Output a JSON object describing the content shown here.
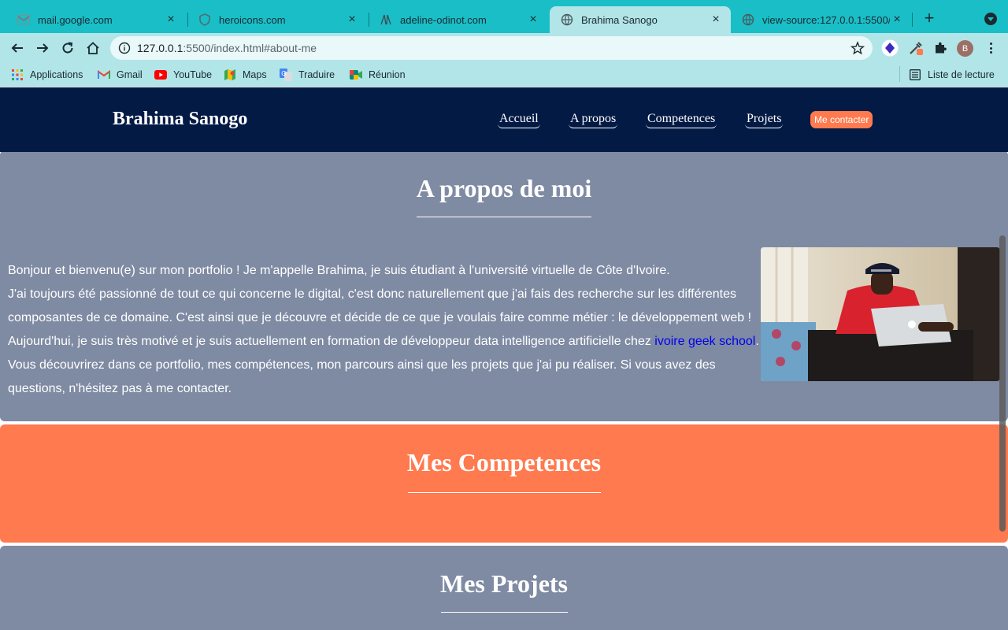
{
  "browser": {
    "tabs": [
      {
        "title": "mail.google.com",
        "icon": "gmail-icon"
      },
      {
        "title": "heroicons.com",
        "icon": "shield-icon"
      },
      {
        "title": "adeline-odinot.com",
        "icon": "ao-logo-icon"
      },
      {
        "title": "Brahima Sanogo",
        "icon": "globe-icon",
        "active": true
      },
      {
        "title": "view-source:127.0.0.1:5500/",
        "icon": "globe-icon"
      }
    ],
    "url_host": "127.0.0.1",
    "url_rest": ":5500/index.html#about-me",
    "profile_initial": "B",
    "bookmarks": [
      {
        "label": "Applications",
        "icon": "apps-grid-icon"
      },
      {
        "label": "Gmail",
        "icon": "gmail-icon"
      },
      {
        "label": "YouTube",
        "icon": "youtube-icon"
      },
      {
        "label": "Maps",
        "icon": "maps-icon"
      },
      {
        "label": "Traduire",
        "icon": "translate-icon"
      },
      {
        "label": "Réunion",
        "icon": "meet-icon"
      }
    ],
    "reading_list": "Liste de lecture"
  },
  "site": {
    "brand": "Brahima Sanogo",
    "nav": [
      "Accueil",
      "A propos",
      "Competences",
      "Projets"
    ],
    "cta": "Me contacter",
    "colors": {
      "header": "#031a45",
      "section_grey": "#7f8ba3",
      "accent": "#ff7a4f",
      "link": "#0000ee"
    }
  },
  "about": {
    "title": "A propos de moi",
    "p1": "Bonjour et bienvenu(e) sur mon portfolio ! Je m'appelle Brahima, je suis étudiant à l'université virtuelle de Côte d'Ivoire.",
    "p2": "J'ai toujours été passionné de tout ce qui concerne le digital, c'est donc naturellement que j'ai fais des recherche sur les différentes composantes de ce domaine. C'est ainsi que je découvre et décide de ce que je voulais faire comme métier : le développement web ! Aujourd'hui, je suis très motivé et je suis actuellement en formation de développeur data intelligence artificielle chez ",
    "link": "ivoire geek school",
    "p2_end": ".",
    "p3": "Vous découvrirez dans ce portfolio, mes compétences, mon parcours ainsi que les projets que j'ai pu réaliser. Si vous avez des questions, n'hésitez pas à me contacter."
  },
  "skills": {
    "title": "Mes Competences"
  },
  "projects": {
    "title": "Mes Projets"
  }
}
